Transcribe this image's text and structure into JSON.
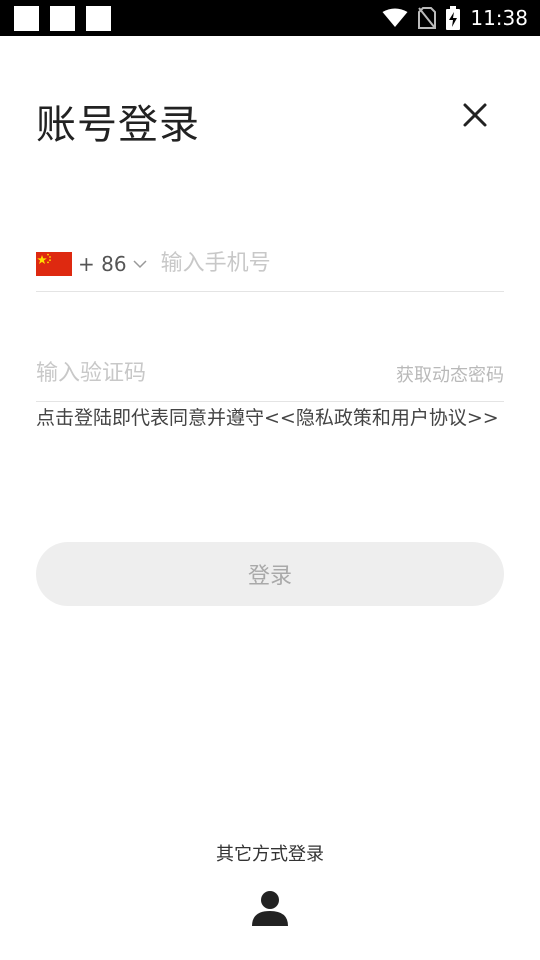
{
  "status_bar": {
    "time": "11:38",
    "icons": [
      "notification-square",
      "notification-square",
      "notification-square",
      "wifi-icon",
      "no-sim-icon",
      "battery-charging-icon"
    ]
  },
  "header": {
    "title": "账号登录",
    "close_icon": "close-icon"
  },
  "phone": {
    "flag_icon": "china-flag-icon",
    "country_code": "+ 86",
    "placeholder": "输入手机号"
  },
  "verification": {
    "placeholder": "输入验证码",
    "get_code_label": "获取动态密码"
  },
  "agreement_text": "点击登陆即代表同意并遵守<<隐私政策和用户协议>>",
  "login_button_label": "登录",
  "other_methods": {
    "label": "其它方式登录",
    "icon": "user-icon"
  },
  "colors": {
    "status_bar_bg": "#000000",
    "button_bg": "#eeeeee",
    "button_text": "#a9a9a9",
    "placeholder": "#c8c8c8",
    "flag_red": "#de2910",
    "flag_star": "#ffde00"
  }
}
